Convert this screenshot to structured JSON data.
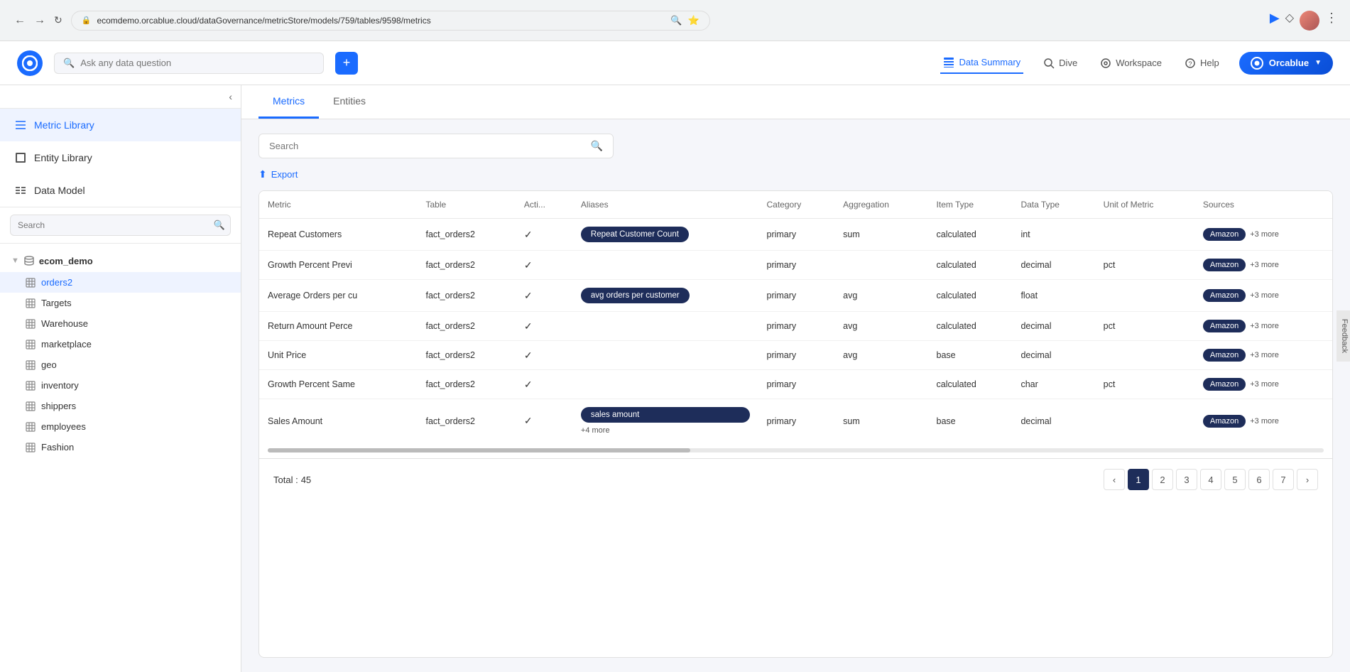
{
  "browser": {
    "url": "ecomdemo.orcablue.cloud/dataGovernance/metricStore/models/759/tables/9598/metrics",
    "back_disabled": false,
    "forward_disabled": false
  },
  "app_header": {
    "logo_letter": "O",
    "search_placeholder": "Ask any data question",
    "add_button_label": "+",
    "nav": [
      {
        "id": "data-summary",
        "label": "Data Summary",
        "icon": "table-icon",
        "active": true
      },
      {
        "id": "dive",
        "label": "Dive",
        "icon": "search-icon",
        "active": false
      },
      {
        "id": "workspace",
        "label": "Workspace",
        "icon": "layers-icon",
        "active": false
      },
      {
        "id": "help",
        "label": "Help",
        "icon": "help-icon",
        "active": false
      }
    ],
    "brand": "Orcablue"
  },
  "sidebar": {
    "collapse_title": "Collapse",
    "nav_items": [
      {
        "id": "metric-library",
        "label": "Metric Library",
        "active": true
      },
      {
        "id": "entity-library",
        "label": "Entity Library",
        "active": false
      },
      {
        "id": "data-model",
        "label": "Data Model",
        "active": false
      }
    ],
    "search_placeholder": "Search",
    "tree": {
      "root": "ecom_demo",
      "items": [
        {
          "id": "orders2",
          "label": "orders2",
          "active": true
        },
        {
          "id": "targets",
          "label": "Targets",
          "active": false
        },
        {
          "id": "warehouse",
          "label": "Warehouse",
          "active": false
        },
        {
          "id": "marketplace",
          "label": "marketplace",
          "active": false
        },
        {
          "id": "geo",
          "label": "geo",
          "active": false
        },
        {
          "id": "inventory",
          "label": "inventory",
          "active": false
        },
        {
          "id": "shippers",
          "label": "shippers",
          "active": false
        },
        {
          "id": "employees",
          "label": "employees",
          "active": false
        },
        {
          "id": "fashion",
          "label": "Fashion",
          "active": false
        }
      ]
    }
  },
  "content": {
    "tabs": [
      {
        "id": "metrics",
        "label": "Metrics",
        "active": true
      },
      {
        "id": "entities",
        "label": "Entities",
        "active": false
      }
    ],
    "search_placeholder": "Search",
    "export_label": "Export",
    "table": {
      "columns": [
        "Metric",
        "Table",
        "Acti...",
        "Aliases",
        "Category",
        "Aggregation",
        "Item Type",
        "Data Type",
        "Unit of Metric",
        "Sources"
      ],
      "rows": [
        {
          "metric": "Repeat Customers",
          "table": "fact_orders2",
          "active": true,
          "aliases": [
            "Repeat Customer Count"
          ],
          "aliases_badge": true,
          "category": "primary",
          "aggregation": "sum",
          "item_type": "calculated",
          "data_type": "int",
          "unit": "",
          "source": "Amazon",
          "more": "+3 more"
        },
        {
          "metric": "Growth Percent Previ",
          "table": "fact_orders2",
          "active": true,
          "aliases": [],
          "aliases_badge": false,
          "category": "primary",
          "aggregation": "",
          "item_type": "calculated",
          "data_type": "decimal",
          "unit": "pct",
          "source": "Amazon",
          "more": "+3 more"
        },
        {
          "metric": "Average Orders per cu",
          "table": "fact_orders2",
          "active": true,
          "aliases": [
            "avg orders per customer"
          ],
          "aliases_badge": true,
          "category": "primary",
          "aggregation": "avg",
          "item_type": "calculated",
          "data_type": "float",
          "unit": "",
          "source": "Amazon",
          "more": "+3 more"
        },
        {
          "metric": "Return Amount Perce",
          "table": "fact_orders2",
          "active": true,
          "aliases": [],
          "aliases_badge": false,
          "category": "primary",
          "aggregation": "avg",
          "item_type": "calculated",
          "data_type": "decimal",
          "unit": "pct",
          "source": "Amazon",
          "more": "+3 more"
        },
        {
          "metric": "Unit Price",
          "table": "fact_orders2",
          "active": true,
          "aliases": [],
          "aliases_badge": false,
          "category": "primary",
          "aggregation": "avg",
          "item_type": "base",
          "data_type": "decimal",
          "unit": "",
          "source": "Amazon",
          "more": "+3 more"
        },
        {
          "metric": "Growth Percent Same",
          "table": "fact_orders2",
          "active": true,
          "aliases": [],
          "aliases_badge": false,
          "category": "primary",
          "aggregation": "",
          "item_type": "calculated",
          "data_type": "char",
          "unit": "pct",
          "source": "Amazon",
          "more": "+3 more"
        },
        {
          "metric": "Sales Amount",
          "table": "fact_orders2",
          "active": true,
          "aliases": [
            "sales amount"
          ],
          "aliases_extra": "+4 more",
          "aliases_badge": true,
          "category": "primary",
          "aggregation": "sum",
          "item_type": "base",
          "data_type": "decimal",
          "unit": "",
          "source": "Amazon",
          "more": "+3 more"
        }
      ]
    },
    "pagination": {
      "total_label": "Total :",
      "total": "45",
      "pages": [
        1,
        2,
        3,
        4,
        5,
        6,
        7
      ],
      "current_page": 1
    }
  },
  "feedback_label": "Feedback"
}
